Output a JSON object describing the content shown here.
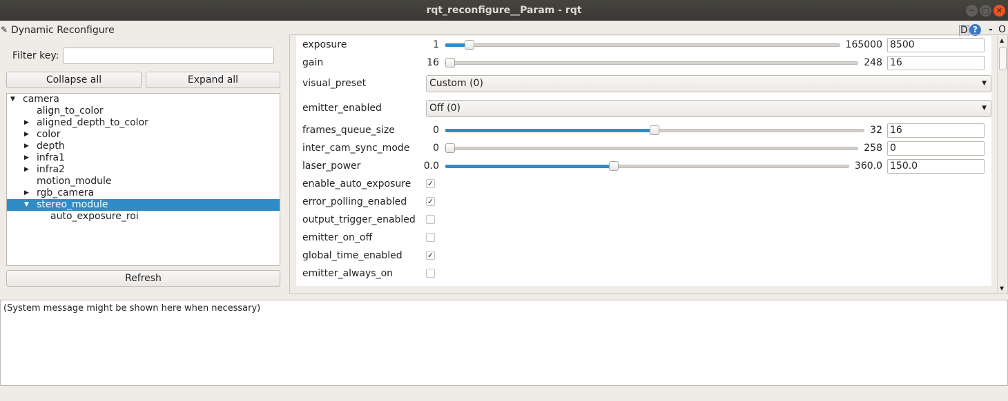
{
  "window": {
    "title": "rqt_reconfigure__Param - rqt",
    "minimize": "─",
    "maximize": "□",
    "close": "✕"
  },
  "plugin": {
    "title": "Dynamic Reconfigure",
    "d_label": "D",
    "help": "?",
    "dash": "-",
    "o": "O"
  },
  "filter": {
    "label": "Filter key:",
    "value": ""
  },
  "buttons": {
    "collapse": "Collapse all",
    "expand": "Expand all",
    "refresh": "Refresh"
  },
  "tree": [
    {
      "label": "camera",
      "level": 0,
      "arrow": "down"
    },
    {
      "label": "align_to_color",
      "level": 1,
      "arrow": ""
    },
    {
      "label": "aligned_depth_to_color",
      "level": 1,
      "arrow": "right"
    },
    {
      "label": "color",
      "level": 1,
      "arrow": "right"
    },
    {
      "label": "depth",
      "level": 1,
      "arrow": "right"
    },
    {
      "label": "infra1",
      "level": 1,
      "arrow": "right"
    },
    {
      "label": "infra2",
      "level": 1,
      "arrow": "right"
    },
    {
      "label": "motion_module",
      "level": 1,
      "arrow": ""
    },
    {
      "label": "rgb_camera",
      "level": 1,
      "arrow": "right"
    },
    {
      "label": "stereo_module",
      "level": 1,
      "arrow": "down",
      "selected": true
    },
    {
      "label": "auto_exposure_roi",
      "level": 2,
      "arrow": ""
    }
  ],
  "params": [
    {
      "name": "exposure",
      "type": "slider",
      "min": "1",
      "max": "165000",
      "value": "8500",
      "fraction": 0.051
    },
    {
      "name": "gain",
      "type": "slider",
      "min": "16",
      "max": "248",
      "value": "16",
      "fraction": 0
    },
    {
      "name": "visual_preset",
      "type": "combo",
      "value": "Custom (0)"
    },
    {
      "name": "emitter_enabled",
      "type": "combo",
      "value": "Off (0)"
    },
    {
      "name": "frames_queue_size",
      "type": "slider",
      "min": "0",
      "max": "32",
      "value": "16",
      "fraction": 0.5
    },
    {
      "name": "inter_cam_sync_mode",
      "type": "slider",
      "min": "0",
      "max": "258",
      "value": "0",
      "fraction": 0
    },
    {
      "name": "laser_power",
      "type": "slider",
      "min": "0.0",
      "max": "360.0",
      "value": "150.0",
      "fraction": 0.4167
    },
    {
      "name": "enable_auto_exposure",
      "type": "check",
      "checked": true
    },
    {
      "name": "error_polling_enabled",
      "type": "check",
      "checked": true
    },
    {
      "name": "output_trigger_enabled",
      "type": "check",
      "checked": false
    },
    {
      "name": "emitter_on_off",
      "type": "check",
      "checked": false
    },
    {
      "name": "global_time_enabled",
      "type": "check",
      "checked": true
    },
    {
      "name": "emitter_always_on",
      "type": "check",
      "checked": false
    }
  ],
  "status": {
    "message": "(System message might be shown here when necessary)"
  },
  "colors": {
    "accent": "#308cc6",
    "close": "#e95420"
  }
}
